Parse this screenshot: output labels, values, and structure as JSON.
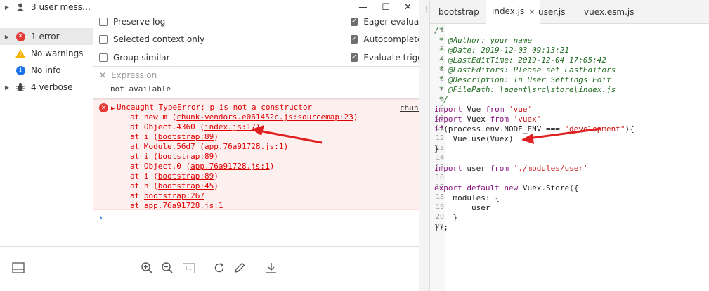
{
  "sidebar": {
    "items": [
      {
        "icon": "user-icon",
        "label": "3 user mess…",
        "expandable": true
      },
      {
        "icon": "error-icon",
        "label": "1 error",
        "expandable": true,
        "active": true
      },
      {
        "icon": "warning-icon",
        "label": "No warnings",
        "expandable": false
      },
      {
        "icon": "info-icon",
        "label": "No info",
        "expandable": false
      },
      {
        "icon": "bug-icon",
        "label": "4 verbose",
        "expandable": true
      }
    ]
  },
  "settings": {
    "preserve_log": "Preserve log",
    "selected_context_only": "Selected context only",
    "group_similar": "Group similar",
    "eager_evaluation": "Eager evaluatio",
    "autocomplete": "Autocomplete",
    "evaluate_triggers": "Evaluate trigge"
  },
  "expression": {
    "label": "Expression",
    "value": "not available"
  },
  "error": {
    "message": "Uncaught TypeError: p is not a constructor",
    "source": "chunk",
    "stack": [
      {
        "prefix": "at new m (",
        "link": "chunk-vendors.e061452c.js:sourcemap:23",
        "suffix": ")"
      },
      {
        "prefix": "at Object.4360 (",
        "link": "index.js:17",
        "suffix": ")"
      },
      {
        "prefix": "at i (",
        "link": "bootstrap:89",
        "suffix": ")"
      },
      {
        "prefix": "at Module.56d7 (",
        "link": "app.76a91728.js:1",
        "suffix": ")"
      },
      {
        "prefix": "at i (",
        "link": "bootstrap:89",
        "suffix": ")"
      },
      {
        "prefix": "at Object.0 (",
        "link": "app.76a91728.js:1",
        "suffix": ")"
      },
      {
        "prefix": "at i (",
        "link": "bootstrap:89",
        "suffix": ")"
      },
      {
        "prefix": "at n (",
        "link": "bootstrap:45",
        "suffix": ")"
      },
      {
        "prefix": "at ",
        "link": "bootstrap:267",
        "suffix": ""
      },
      {
        "prefix": "at ",
        "link": "app.76a91728.js:1",
        "suffix": ""
      }
    ]
  },
  "prompt": "›",
  "window": {
    "minimize": "—",
    "maximize": "☐",
    "close": "✕"
  },
  "toolbar": {
    "dock_icon": "dock-icon",
    "zoom_in_icon": "zoom-in-icon",
    "zoom_out_icon": "zoom-out-icon",
    "fit_icon": "fit-icon",
    "fit_label": "11",
    "refresh_icon": "refresh-icon",
    "edit_icon": "edit-icon",
    "download_icon": "download-icon"
  },
  "sources": {
    "tabs": [
      {
        "label": "bootstrap",
        "active": false
      },
      {
        "label": "index.js",
        "active": true,
        "close": "×"
      },
      {
        "label": "user.js",
        "active": false
      },
      {
        "label": "vuex.esm.js",
        "active": false
      }
    ],
    "lines": [
      {
        "n": "1",
        "text": "/*",
        "type": "comment"
      },
      {
        "n": "2",
        "text": " * @Author: your name",
        "type": "comment"
      },
      {
        "n": "3",
        "text": " * @Date: 2019-12-03 09:13:21",
        "type": "comment"
      },
      {
        "n": "4",
        "text": " * @LastEditTime: 2019-12-04 17:05:42",
        "type": "comment"
      },
      {
        "n": "5",
        "text": " * @LastEditors: Please set LastEditors",
        "type": "comment"
      },
      {
        "n": "6",
        "text": " * @Description: In User Settings Edit",
        "type": "comment"
      },
      {
        "n": "7",
        "text": " * @FilePath: \\agent\\src\\store\\index.js",
        "type": "comment"
      },
      {
        "n": "8",
        "text": " */",
        "type": "comment"
      },
      {
        "n": "9",
        "text": "import Vue from 'vue'",
        "type": "code"
      },
      {
        "n": "10",
        "text": "import Vuex from 'vuex'",
        "type": "code"
      },
      {
        "n": "11",
        "text": "if(process.env.NODE_ENV === \"development\"){",
        "type": "code"
      },
      {
        "n": "12",
        "text": "    Vue.use(Vuex)",
        "type": "code"
      },
      {
        "n": "13",
        "text": "}",
        "type": "code"
      },
      {
        "n": "14",
        "text": "",
        "type": "code"
      },
      {
        "n": "15",
        "text": "import user from './modules/user'",
        "type": "code"
      },
      {
        "n": "16",
        "text": "",
        "type": "code"
      },
      {
        "n": "17",
        "text": "export default new Vuex.Store({",
        "type": "code"
      },
      {
        "n": "18",
        "text": "    modules: {",
        "type": "code"
      },
      {
        "n": "19",
        "text": "        user",
        "type": "code"
      },
      {
        "n": "20",
        "text": "    }",
        "type": "code"
      },
      {
        "n": "21",
        "text": "});",
        "type": "code"
      }
    ]
  },
  "colors": {
    "error_red": "#e53935",
    "error_bg": "#fff0f0",
    "annotation_arrow": "#e02020",
    "comment_green": "#236e25"
  }
}
